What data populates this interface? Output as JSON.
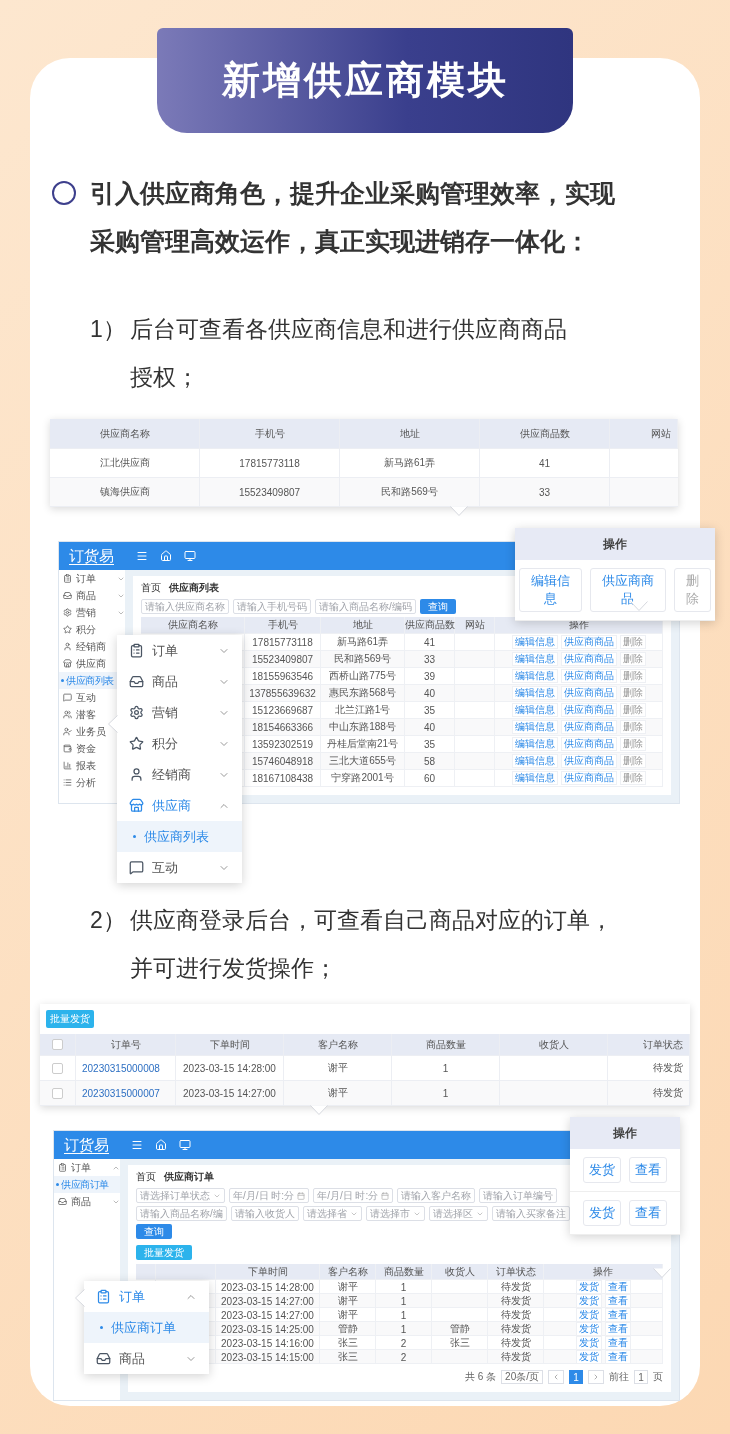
{
  "banner": {
    "title": "新增供应商模块"
  },
  "intro": "引入供应商角色，提升企业采购管理效率，实现采购管理高效运作，真正实现进销存一体化：",
  "section_1": {
    "number": "1）",
    "caption": "后台可查看各供应商信息和进行供应商商品授权；",
    "zoom_table": {
      "columns": [
        "供应商名称",
        "手机号",
        "地址",
        "供应商品数",
        "网站"
      ],
      "rows": [
        [
          "江北供应商",
          "17815773118",
          "新马路61弄",
          "41"
        ],
        [
          "镇海供应商",
          "15523409807",
          "民和路569号",
          "33"
        ]
      ]
    },
    "app": {
      "logo": "订货易",
      "sidebar": [
        {
          "label": "订单",
          "expanded": false
        },
        {
          "label": "商品",
          "expanded": false
        },
        {
          "label": "营销",
          "expanded": false
        },
        {
          "label": "积分"
        },
        {
          "label": "经销商"
        },
        {
          "label": "供应商",
          "children": [
            {
              "label": "供应商列表",
              "selected": true
            }
          ]
        },
        {
          "label": "互动"
        },
        {
          "label": "潜客"
        },
        {
          "label": "业务员"
        },
        {
          "label": "资金"
        },
        {
          "label": "报表"
        },
        {
          "label": "分析"
        }
      ],
      "breadcrumb": [
        "首页",
        "供应商列表"
      ],
      "filters": [
        {
          "placeholder": "请输入供应商名称"
        },
        {
          "placeholder": "请输入手机号码"
        },
        {
          "placeholder": "请输入商品名称/编码"
        }
      ],
      "search_button": "查询",
      "columns": [
        "供应商名称",
        "手机号",
        "地址",
        "供应商品数",
        "网站",
        "操作"
      ],
      "rows": [
        {
          "phone": "17815773118",
          "address": "新马路61弄",
          "count": "41",
          "actions": [
            "编辑信息",
            "供应商商品",
            "删除"
          ]
        },
        {
          "phone": "15523409807",
          "address": "民和路569号",
          "count": "33",
          "actions": [
            "编辑信息",
            "供应商商品",
            "删除"
          ]
        },
        {
          "phone": "18155963546",
          "address": "西桥山路775号",
          "count": "39",
          "actions": [
            "编辑信息",
            "供应商商品",
            "删除"
          ]
        },
        {
          "phone": "137855639632",
          "address": "惠民东路568号",
          "count": "40",
          "actions": [
            "编辑信息",
            "供应商商品",
            "删除"
          ]
        },
        {
          "phone": "15123669687",
          "address": "北兰江路1号",
          "count": "35",
          "actions": [
            "编辑信息",
            "供应商商品",
            "删除"
          ]
        },
        {
          "phone": "18154663366",
          "address": "中山东路188号",
          "count": "40",
          "actions": [
            "编辑信息",
            "供应商商品",
            "删除"
          ]
        },
        {
          "phone": "13592302519",
          "address": "丹桂后堂南21号",
          "count": "35",
          "actions": [
            "编辑信息",
            "供应商商品",
            "删除"
          ]
        },
        {
          "phone": "15746048918",
          "address": "三北大道655号",
          "count": "58",
          "actions": [
            "编辑信息",
            "供应商商品",
            "删除"
          ]
        },
        {
          "phone": "18167108438",
          "address": "宁穿路2001号",
          "count": "60",
          "actions": [
            "编辑信息",
            "供应商商品",
            "删除"
          ]
        }
      ]
    },
    "actions_popup": {
      "title": "操作",
      "rows": [
        [
          {
            "label": "编辑信息",
            "kind": "link"
          },
          {
            "label": "供应商商品",
            "kind": "link"
          },
          {
            "label": "删除",
            "kind": "muted"
          }
        ]
      ]
    },
    "menu_popup": {
      "items": [
        {
          "label": "订单",
          "expanded": false
        },
        {
          "label": "商品",
          "expanded": false
        },
        {
          "label": "营销",
          "expanded": false
        },
        {
          "label": "积分",
          "expanded": false
        },
        {
          "label": "经销商",
          "expanded": false
        },
        {
          "label": "供应商",
          "expanded": true,
          "children": [
            {
              "label": "供应商列表",
              "selected": true
            }
          ]
        },
        {
          "label": "互动",
          "expanded": false
        }
      ]
    }
  },
  "section_2": {
    "number": "2）",
    "caption": "供应商登录后台，可查看自己商品对应的订单，并可进行发货操作；",
    "zoom_table": {
      "batch_button": "批量发货",
      "select_all_checked": false,
      "columns": [
        "订单号",
        "下单时间",
        "客户名称",
        "商品数量",
        "收货人",
        "订单状态"
      ],
      "rows": [
        {
          "checked": false,
          "cells": [
            "20230315000008",
            "2023-03-15 14:28:00",
            "谢平",
            "1",
            "",
            "待发货"
          ]
        },
        {
          "checked": false,
          "cells": [
            "20230315000007",
            "2023-03-15 14:27:00",
            "谢平",
            "1",
            "",
            "待发货"
          ]
        }
      ]
    },
    "app": {
      "logo": "订货易",
      "sidebar": [
        {
          "label": "订单",
          "expanded": true,
          "children": [
            {
              "label": "供应商订单",
              "selected": true
            }
          ]
        },
        {
          "label": "商品",
          "expanded": false
        }
      ],
      "breadcrumb": [
        "首页",
        "供应商订单"
      ],
      "filters": [
        {
          "placeholder": "请选择订单状态",
          "kind": "select"
        },
        {
          "placeholder": "年/月/日 时:分",
          "kind": "date"
        },
        {
          "placeholder": "年/月/日 时:分",
          "kind": "date"
        },
        {
          "placeholder": "请输入客户名称",
          "kind": "text"
        },
        {
          "placeholder": "请输入订单编号",
          "kind": "text"
        },
        {
          "placeholder": "请输入商品名称/编",
          "kind": "text"
        },
        {
          "placeholder": "请输入收货人",
          "kind": "text"
        },
        {
          "placeholder": "请选择省",
          "kind": "select"
        },
        {
          "placeholder": "请选择市",
          "kind": "select"
        },
        {
          "placeholder": "请选择区",
          "kind": "select"
        },
        {
          "placeholder": "请输入买家备注",
          "kind": "text"
        }
      ],
      "search_button": "查询",
      "batch_button": "批量发货",
      "columns": [
        "下单时间",
        "客户名称",
        "商品数量",
        "收货人",
        "订单状态",
        "操作"
      ],
      "rows": [
        {
          "cells": [
            "2023-03-15 14:28:00",
            "谢平",
            "1",
            "",
            "待发货"
          ],
          "actions": [
            "发货",
            "查看"
          ]
        },
        {
          "cells": [
            "2023-03-15 14:27:00",
            "谢平",
            "1",
            "",
            "待发货"
          ],
          "actions": [
            "发货",
            "查看"
          ]
        },
        {
          "cells": [
            "2023-03-15 14:27:00",
            "谢平",
            "1",
            "",
            "待发货"
          ],
          "actions": [
            "发货",
            "查看"
          ]
        },
        {
          "cells": [
            "2023-03-15 14:25:00",
            "管静",
            "1",
            "管静",
            "待发货"
          ],
          "actions": [
            "发货",
            "查看"
          ]
        },
        {
          "cells": [
            "2023-03-15 14:16:00",
            "张三",
            "2",
            "张三",
            "待发货"
          ],
          "actions": [
            "发货",
            "查看"
          ]
        },
        {
          "cells": [
            "2023-03-15 14:15:00",
            "张三",
            "2",
            "",
            "待发货"
          ],
          "actions": [
            "发货",
            "查看"
          ]
        }
      ],
      "pagination": {
        "total": "共 6 条",
        "page_size": "20条/页",
        "pages": [
          {
            "label": "1",
            "selected": true
          }
        ],
        "goto_label": "前往",
        "goto_value": "1",
        "goto_unit": "页"
      }
    },
    "actions_popup": {
      "title": "操作",
      "rows": [
        [
          {
            "label": "发货",
            "kind": "link"
          },
          {
            "label": "查看",
            "kind": "link"
          }
        ],
        [
          {
            "label": "发货",
            "kind": "link"
          },
          {
            "label": "查看",
            "kind": "link"
          }
        ]
      ]
    },
    "menu_popup": {
      "items": [
        {
          "label": "订单",
          "expanded": true,
          "children": [
            {
              "label": "供应商订单",
              "selected": true
            }
          ]
        },
        {
          "label": "商品",
          "expanded": false
        }
      ]
    }
  }
}
